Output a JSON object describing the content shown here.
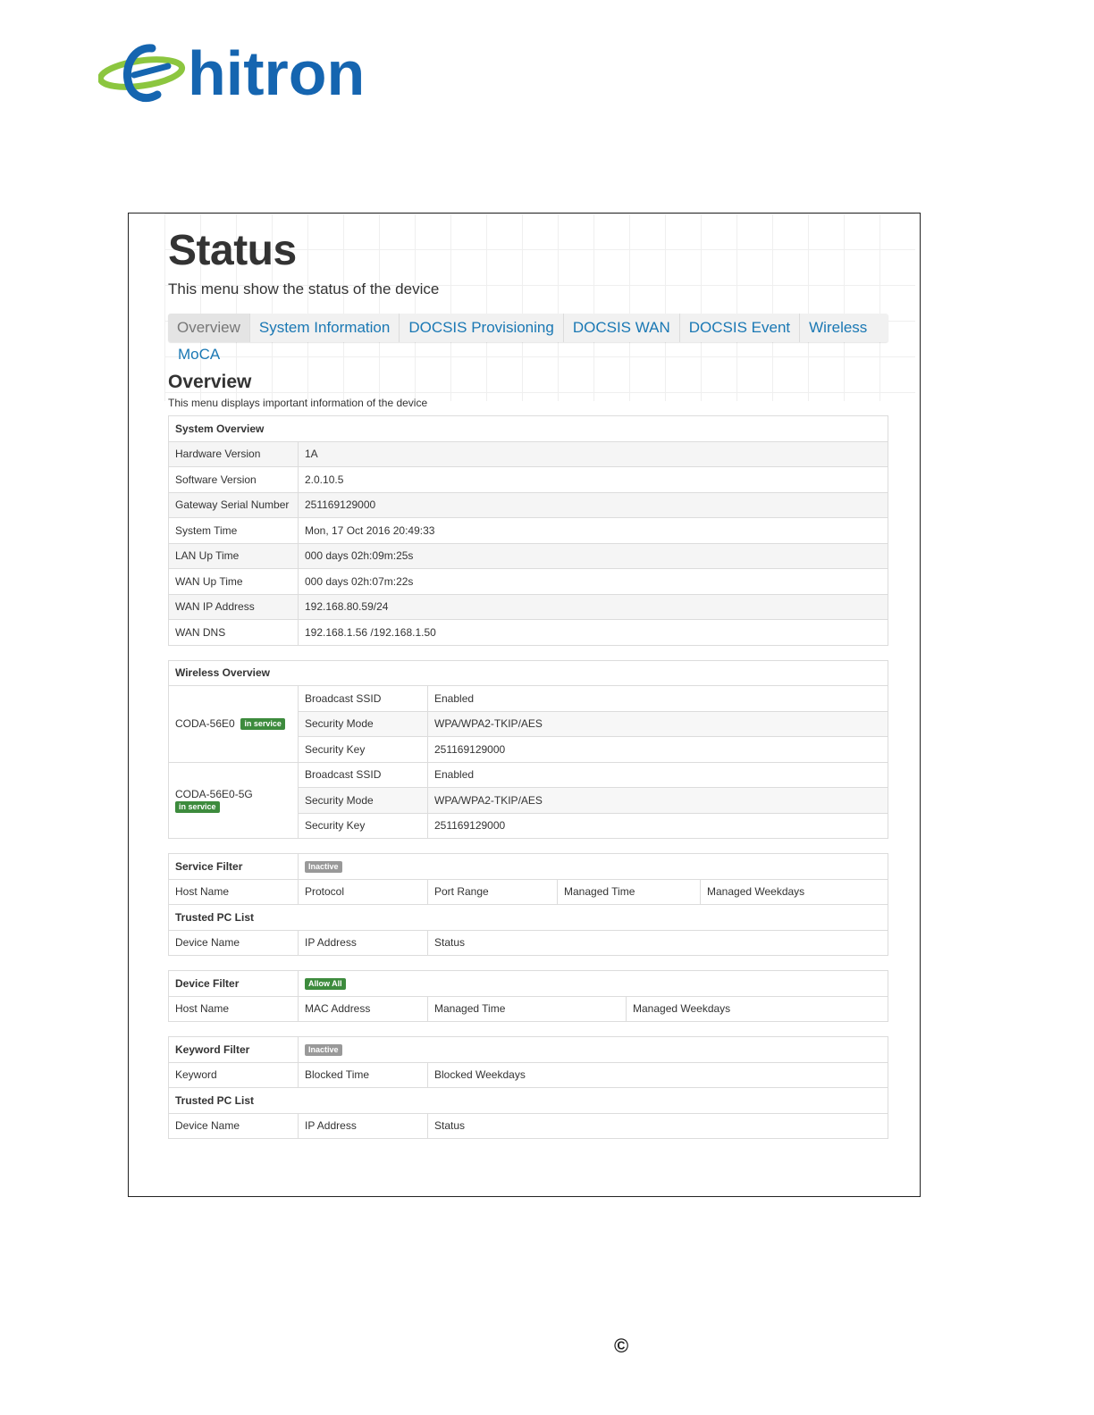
{
  "logo": {
    "text": "hitron",
    "colors": {
      "blue": "#1565b0",
      "green": "#8cc63f"
    }
  },
  "page": {
    "title": "Status",
    "subtitle": "This menu show the status of the device"
  },
  "tabs": [
    "Overview",
    "System Information",
    "DOCSIS Provisioning",
    "DOCSIS WAN",
    "DOCSIS Event",
    "Wireless",
    "MoCA"
  ],
  "section": {
    "title": "Overview",
    "subtitle": "This menu displays important information of the device"
  },
  "system_overview": {
    "title": "System Overview",
    "rows": [
      {
        "label": "Hardware Version",
        "value": "1A"
      },
      {
        "label": "Software Version",
        "value": "2.0.10.5"
      },
      {
        "label": "Gateway Serial Number",
        "value": "251169129000"
      },
      {
        "label": "System Time",
        "value": "Mon, 17 Oct 2016 20:49:33"
      },
      {
        "label": "LAN Up Time",
        "value": "000 days 02h:09m:25s"
      },
      {
        "label": "WAN Up Time",
        "value": "000 days 02h:07m:22s"
      },
      {
        "label": "WAN IP Address",
        "value": "192.168.80.59/24"
      },
      {
        "label": "WAN DNS",
        "value": "192.168.1.56 /192.168.1.50"
      }
    ]
  },
  "wireless_overview": {
    "title": "Wireless Overview",
    "networks": [
      {
        "ssid": "CODA-56E0",
        "badge": "in service",
        "rows": [
          {
            "label": "Broadcast SSID",
            "value": "Enabled"
          },
          {
            "label": "Security Mode",
            "value": "WPA/WPA2-TKIP/AES"
          },
          {
            "label": "Security Key",
            "value": "251169129000"
          }
        ]
      },
      {
        "ssid": "CODA-56E0-5G",
        "badge": "in service",
        "rows": [
          {
            "label": "Broadcast SSID",
            "value": "Enabled"
          },
          {
            "label": "Security Mode",
            "value": "WPA/WPA2-TKIP/AES"
          },
          {
            "label": "Security Key",
            "value": "251169129000"
          }
        ]
      }
    ]
  },
  "service_filter": {
    "title": "Service Filter",
    "badge": "Inactive",
    "columns": [
      "Host Name",
      "Protocol",
      "Port Range",
      "Managed Time",
      "Managed Weekdays"
    ],
    "trusted_title": "Trusted PC List",
    "trusted_columns": [
      "Device Name",
      "IP Address",
      "Status"
    ]
  },
  "device_filter": {
    "title": "Device Filter",
    "badge": "Allow All",
    "columns": [
      "Host Name",
      "MAC Address",
      "Managed Time",
      "Managed Weekdays"
    ]
  },
  "keyword_filter": {
    "title": "Keyword Filter",
    "badge": "Inactive",
    "columns": [
      "Keyword",
      "Blocked Time",
      "Blocked Weekdays"
    ],
    "trusted_title": "Trusted PC List",
    "trusted_columns": [
      "Device Name",
      "IP Address",
      "Status"
    ]
  },
  "footer": {
    "symbol": "©"
  }
}
